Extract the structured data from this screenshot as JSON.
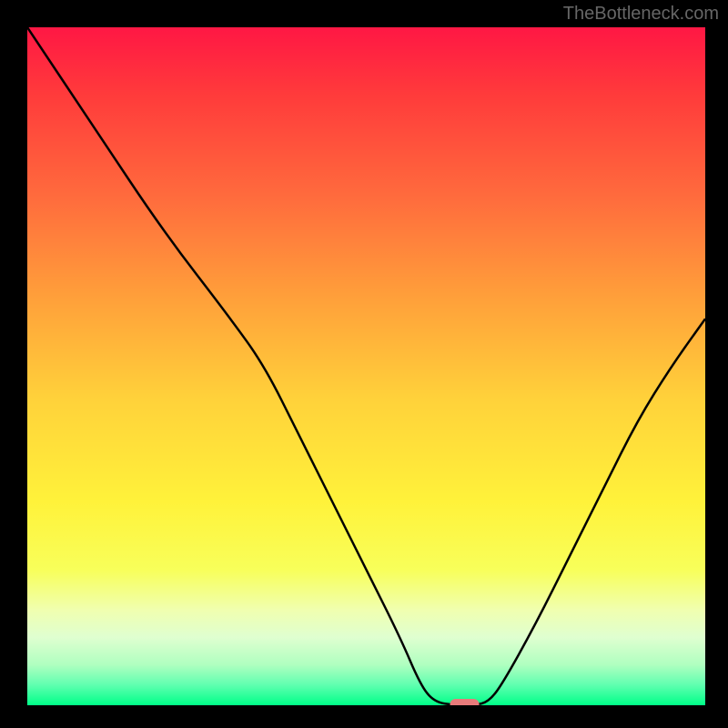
{
  "watermark": "TheBottleneck.com",
  "chart_data": {
    "type": "line",
    "title": "",
    "xlabel": "",
    "ylabel": "",
    "xlim": [
      0,
      100
    ],
    "ylim": [
      0,
      100
    ],
    "curve": [
      {
        "x": 0,
        "y": 100
      },
      {
        "x": 10,
        "y": 85
      },
      {
        "x": 20,
        "y": 70
      },
      {
        "x": 30,
        "y": 57
      },
      {
        "x": 35,
        "y": 50
      },
      {
        "x": 40,
        "y": 40
      },
      {
        "x": 45,
        "y": 30
      },
      {
        "x": 50,
        "y": 20
      },
      {
        "x": 55,
        "y": 10
      },
      {
        "x": 58,
        "y": 3
      },
      {
        "x": 60,
        "y": 0.5
      },
      {
        "x": 63,
        "y": 0
      },
      {
        "x": 66,
        "y": 0
      },
      {
        "x": 68,
        "y": 0.5
      },
      {
        "x": 70,
        "y": 3
      },
      {
        "x": 75,
        "y": 12
      },
      {
        "x": 80,
        "y": 22
      },
      {
        "x": 85,
        "y": 32
      },
      {
        "x": 90,
        "y": 42
      },
      {
        "x": 95,
        "y": 50
      },
      {
        "x": 100,
        "y": 57
      }
    ],
    "marker": {
      "x": 64.5,
      "y": 0,
      "color": "#e77a7a"
    },
    "gradient_stops": [
      {
        "offset": 0.0,
        "color": "#ff1744"
      },
      {
        "offset": 0.1,
        "color": "#ff3b3b"
      },
      {
        "offset": 0.25,
        "color": "#ff6b3d"
      },
      {
        "offset": 0.4,
        "color": "#ffa03a"
      },
      {
        "offset": 0.55,
        "color": "#ffd23a"
      },
      {
        "offset": 0.7,
        "color": "#fff23a"
      },
      {
        "offset": 0.8,
        "color": "#f8ff5a"
      },
      {
        "offset": 0.86,
        "color": "#f0ffb0"
      },
      {
        "offset": 0.9,
        "color": "#dfffd0"
      },
      {
        "offset": 0.94,
        "color": "#b0ffc0"
      },
      {
        "offset": 0.97,
        "color": "#60ffb0"
      },
      {
        "offset": 1.0,
        "color": "#00ff88"
      }
    ]
  }
}
